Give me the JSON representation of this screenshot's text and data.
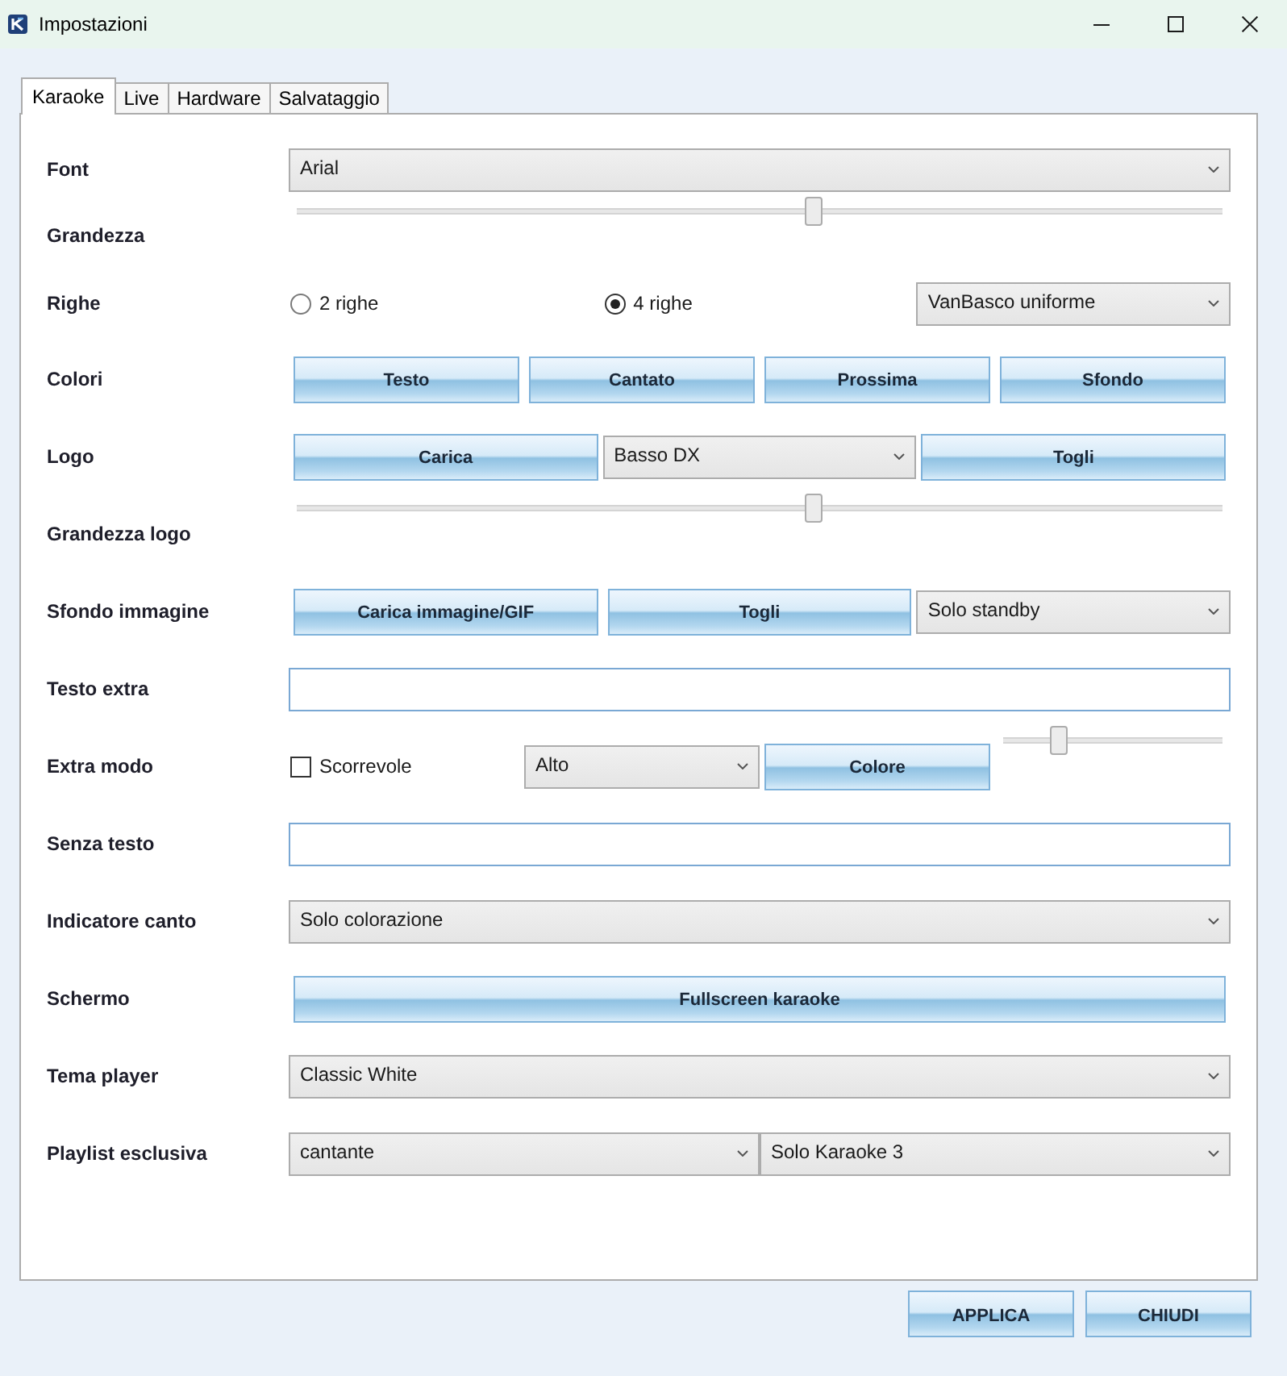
{
  "window": {
    "title": "Impostazioni"
  },
  "tabs": [
    {
      "label": "Karaoke",
      "selected": true
    },
    {
      "label": "Live",
      "selected": false
    },
    {
      "label": "Hardware",
      "selected": false
    },
    {
      "label": "Salvataggio",
      "selected": false
    }
  ],
  "settings": [
    {
      "label": "Font",
      "controls": [
        {
          "kind": "dropdown",
          "value": "Arial"
        }
      ]
    },
    {
      "label": "Grandezza",
      "controls": [
        {
          "kind": "slider",
          "level": 0.56
        }
      ]
    },
    {
      "label": "Righe",
      "controls": [
        {
          "kind": "radio",
          "label": "2 righe",
          "selected": false
        },
        {
          "kind": "radio",
          "label": "4 righe",
          "selected": true
        },
        {
          "kind": "dropdown",
          "value": "VanBasco uniforme"
        }
      ]
    },
    {
      "label": "Colori",
      "controls": [
        {
          "kind": "button",
          "label": "Testo"
        },
        {
          "kind": "button",
          "label": "Cantato"
        },
        {
          "kind": "button",
          "label": "Prossima"
        },
        {
          "kind": "button",
          "label": "Sfondo"
        }
      ]
    },
    {
      "label": "Logo",
      "controls": [
        {
          "kind": "button",
          "label": "Carica"
        },
        {
          "kind": "dropdown",
          "value": "Basso DX"
        },
        {
          "kind": "button",
          "label": "Togli"
        }
      ]
    },
    {
      "label": "Grandezza logo",
      "controls": [
        {
          "kind": "slider",
          "level": 0.56
        }
      ]
    },
    {
      "label": "Sfondo immagine",
      "controls": [
        {
          "kind": "button",
          "label": "Carica immagine/GIF"
        },
        {
          "kind": "button",
          "label": "Togli"
        },
        {
          "kind": "dropdown",
          "value": "Solo standby"
        }
      ]
    },
    {
      "label": "Testo extra",
      "controls": [
        {
          "kind": "input"
        }
      ]
    },
    {
      "label": "Extra modo",
      "controls": [
        {
          "kind": "checkbox",
          "label": "Scorrevole",
          "checked": false
        },
        {
          "kind": "dropdown",
          "value": "Alto"
        },
        {
          "kind": "button",
          "label": "Colore"
        },
        {
          "kind": "slider",
          "level": 0.23
        }
      ]
    },
    {
      "label": "Senza testo",
      "controls": [
        {
          "kind": "input"
        }
      ]
    },
    {
      "label": "Indicatore canto",
      "controls": [
        {
          "kind": "dropdown",
          "value": "Solo colorazione"
        }
      ]
    },
    {
      "label": "Schermo",
      "controls": [
        {
          "kind": "button",
          "label": "Fullscreen karaoke"
        }
      ]
    },
    {
      "label": "Tema player",
      "controls": [
        {
          "kind": "dropdown",
          "value": "Classic White"
        }
      ]
    },
    {
      "label": "Playlist esclusiva",
      "controls": [
        {
          "kind": "dropdown",
          "value": "cantante"
        },
        {
          "kind": "dropdown",
          "value": "Solo Karaoke 3"
        }
      ]
    }
  ],
  "buttons": [
    {
      "label": "APPLICA"
    },
    {
      "label": "CHIUDI"
    }
  ]
}
